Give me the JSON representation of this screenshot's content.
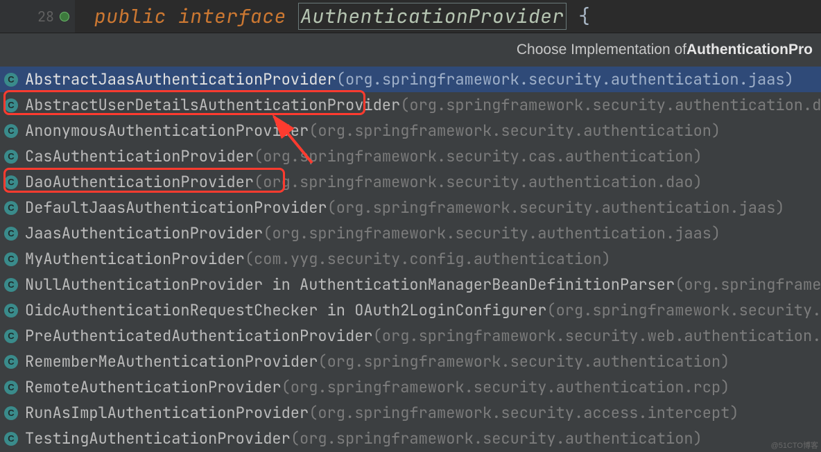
{
  "editor": {
    "line_number": "28",
    "kw_public": "public",
    "kw_interface": "interface",
    "identifier": "AuthenticationProvider",
    "brace": "{"
  },
  "popup": {
    "header_prefix": "Choose Implementation of ",
    "header_target": "AuthenticationPro"
  },
  "implementations": [
    {
      "icon": "C",
      "name": "AbstractJaasAuthenticationProvider",
      "suffix": "",
      "pkg": "(org.springframework.security.authentication.jaas)",
      "selected": true
    },
    {
      "icon": "C",
      "name": "AbstractUserDetailsAuthenticationProvider",
      "suffix": "",
      "pkg": "(org.springframework.security.authentication.dao)",
      "selected": false
    },
    {
      "icon": "C",
      "name": "AnonymousAuthenticationProvider",
      "suffix": "",
      "pkg": "(org.springframework.security.authentication)",
      "selected": false
    },
    {
      "icon": "C",
      "name": "CasAuthenticationProvider",
      "suffix": "",
      "pkg": "(org.springframework.security.cas.authentication)",
      "selected": false
    },
    {
      "icon": "C",
      "name": "DaoAuthenticationProvider",
      "suffix": "",
      "pkg": "(org.springframework.security.authentication.dao)",
      "selected": false
    },
    {
      "icon": "C",
      "name": "DefaultJaasAuthenticationProvider",
      "suffix": "",
      "pkg": "(org.springframework.security.authentication.jaas)",
      "selected": false
    },
    {
      "icon": "C",
      "name": "JaasAuthenticationProvider",
      "suffix": "",
      "pkg": "(org.springframework.security.authentication.jaas)",
      "selected": false
    },
    {
      "icon": "C",
      "name": "MyAuthenticationProvider",
      "suffix": "",
      "pkg": "(com.yyg.security.config.authentication)",
      "selected": false
    },
    {
      "icon": "C",
      "name": "NullAuthenticationProvider",
      "suffix": " in AuthenticationManagerBeanDefinitionParser",
      "pkg": "(org.springframework",
      "selected": false
    },
    {
      "icon": "C",
      "name": "OidcAuthenticationRequestChecker",
      "suffix": " in OAuth2LoginConfigurer",
      "pkg": "(org.springframework.security.conf",
      "selected": false
    },
    {
      "icon": "C",
      "name": "PreAuthenticatedAuthenticationProvider",
      "suffix": "",
      "pkg": "(org.springframework.security.web.authentication.prea",
      "selected": false
    },
    {
      "icon": "C",
      "name": "RememberMeAuthenticationProvider",
      "suffix": "",
      "pkg": "(org.springframework.security.authentication)",
      "selected": false
    },
    {
      "icon": "C",
      "name": "RemoteAuthenticationProvider",
      "suffix": "",
      "pkg": "(org.springframework.security.authentication.rcp)",
      "selected": false
    },
    {
      "icon": "C",
      "name": "RunAsImplAuthenticationProvider",
      "suffix": "",
      "pkg": "(org.springframework.security.access.intercept)",
      "selected": false
    },
    {
      "icon": "C",
      "name": "TestingAuthenticationProvider",
      "suffix": "",
      "pkg": "(org.springframework.security.authentication)",
      "selected": false
    }
  ],
  "watermark": "@51CTO博客"
}
